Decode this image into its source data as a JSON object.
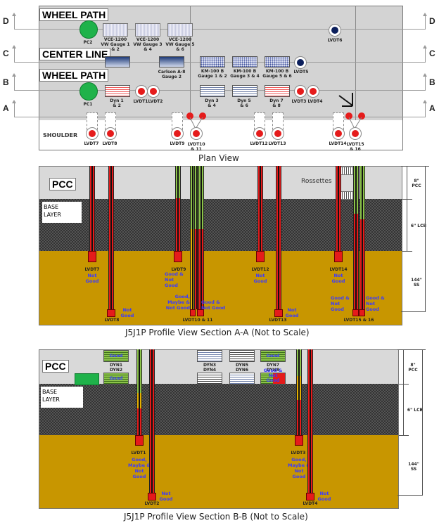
{
  "plan_view": {
    "caption": "Plan View",
    "rows": {
      "wheel_path_top": "WHEEL PATH",
      "center_line": "CENTER LINE",
      "wheel_path_bottom": "WHEEL PATH",
      "shoulder": "SHOULDER"
    },
    "section_letters": [
      "D",
      "C",
      "B",
      "A"
    ],
    "pressure_cells": [
      {
        "id": "PC2",
        "row": "D"
      },
      {
        "id": "PC1",
        "row": "B"
      }
    ],
    "vw_gauges": [
      {
        "label": "VCE-1200\nVW Gauge 1\n& 2"
      },
      {
        "label": "VCE-1200\nVW Gauge 3\n& 4"
      },
      {
        "label": "VCE-1200\nVW Gauge 5\n& 6"
      }
    ],
    "carlson_gauges": [
      {
        "label": ""
      },
      {
        "label": "Carlson A-8\nGauge 2"
      }
    ],
    "km_gauges": [
      {
        "label": "KM-100 B\nGauge 1 & 2"
      },
      {
        "label": "KM-100 B\nGauge 3 & 4"
      },
      {
        "label": "KM-100 B\nGauge 5 & 6"
      }
    ],
    "dyn_gauges": [
      {
        "label": "Dyn 1\n& 2",
        "color": "red"
      },
      {
        "label": "Dyn 3\n& 4",
        "color": "blue"
      },
      {
        "label": "Dyn 5\n& 6",
        "color": "blue"
      },
      {
        "label": "Dyn 7\n& 8",
        "color": "red"
      }
    ],
    "lvdt_labels": {
      "LVDT1": "LVDT1",
      "LVDT2": "LVDT2",
      "LVDT3": "LVDT3",
      "LVDT4": "LVDT4",
      "LVDT5": "LVDT5",
      "LVDT6": "LVDT6",
      "LVDT7": "LVDT7",
      "LVDT8": "LVDT8",
      "LVDT9": "LVDT9",
      "LVDT10_11": "LVDT10\n& 11",
      "LVDT12": "LVDT12",
      "LVDT13": "LVDT13",
      "LVDT14": "LVDT14",
      "LVDT15_16": "LVDT15\n& 16"
    }
  },
  "section_aa": {
    "caption": "J5J1P Profile View Section A-A (Not to Scale)",
    "layers": {
      "pcc": "PCC",
      "base": "BASE\nLAYER"
    },
    "rossettes": "Rossettes",
    "dimensions": {
      "pcc": "8\"\nPCC",
      "lcb": "6\" LCB",
      "ss": "144\"\nSS"
    },
    "probes": [
      {
        "label": "LVDT7",
        "status": "Not\nGood"
      },
      {
        "label": "LVDT8",
        "status": "Not\nGood"
      },
      {
        "label": "LVDT9",
        "status": "Good &\nNot\nGood"
      },
      {
        "label": "LVDT10 & 11",
        "status_left": "Good,\nMaybe &\nNot Good",
        "status_right": "Good &\nNot Good"
      },
      {
        "label": "LVDT12",
        "status": "Not\nGood"
      },
      {
        "label": "LVDT13",
        "status": "Not\nGood"
      },
      {
        "label": "LVDT14",
        "status": "Not\nGood"
      },
      {
        "label": "LVDT15 & 16",
        "status_left": "Good &\nNot\nGood",
        "status_right": "Good &\nNot\nGood"
      }
    ]
  },
  "section_bb": {
    "caption": "J5J1P Profile View Section B-B (Not to Scale)",
    "layers": {
      "pcc": "PCC",
      "base": "BASE\nLAYER"
    },
    "dimensions": {
      "pcc": "8\"\nPCC",
      "lcb": "6\" LCB",
      "ss": "144\"\nSS"
    },
    "dyn_pairs": [
      {
        "label": "DYN1\nDYN2",
        "top_status": "Good",
        "bottom_status": "Good"
      },
      {
        "label": "DYN3\nDYN4"
      },
      {
        "label": "DYN5\nDYN6"
      },
      {
        "label": "DYN7\nDYN8",
        "top_status": "Good",
        "bottom_status": "Good &\nNot\nGood"
      }
    ],
    "probes": [
      {
        "label": "LVDT1",
        "status": "Good,\nMaybe &\nNot\nGood"
      },
      {
        "label": "LVDT2",
        "status": "Not\nGood"
      },
      {
        "label": "LVDT3",
        "status": "Good,\nMaybe &\nNot\nGood"
      },
      {
        "label": "LVDT4",
        "status": "Not\nGood"
      }
    ]
  },
  "colors": {
    "status_text": "#3a3aff",
    "probe_red": "#e51b1b",
    "probe_green": "#8cc34a",
    "probe_yellow": "#e6b000",
    "subgrade": "#c89600",
    "pressure_cell": "#1fb24a"
  }
}
